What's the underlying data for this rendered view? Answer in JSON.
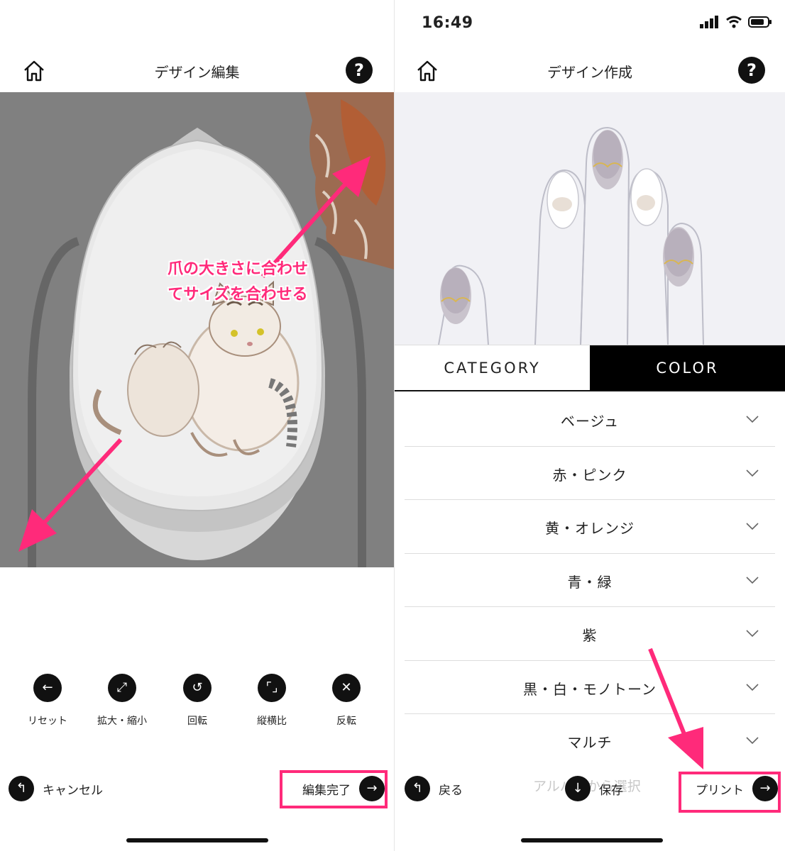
{
  "left": {
    "title": "デザイン編集",
    "help": "?",
    "annotation": [
      "爪の大きさに合わせ",
      "てサイズを合わせる"
    ],
    "tools": [
      {
        "label": "リセット",
        "icon": "arrow-left-icon"
      },
      {
        "label": "拡大・縮小",
        "icon": "expand-icon"
      },
      {
        "label": "回転",
        "icon": "rotate-icon"
      },
      {
        "label": "縦横比",
        "icon": "aspect-ratio-icon"
      },
      {
        "label": "反転",
        "icon": "flip-icon"
      }
    ],
    "cancel_label": "キャンセル",
    "done_label": "編集完了"
  },
  "right": {
    "status_time": "16:49",
    "title": "デザイン作成",
    "help": "?",
    "tabs": [
      "CATEGORY",
      "COLOR"
    ],
    "active_tab": "COLOR",
    "colors": [
      "ベージュ",
      "赤・ピンク",
      "黄・オレンジ",
      "青・緑",
      "紫",
      "黒・白・モノトーン",
      "マルチ"
    ],
    "back_label": "戻る",
    "save_label": "保存",
    "album_label": "アルバムから選択",
    "print_label": "プリント"
  },
  "colors": {
    "accent": "#ff2a7a",
    "dark": "#111111",
    "edit_bg": "#808080"
  }
}
